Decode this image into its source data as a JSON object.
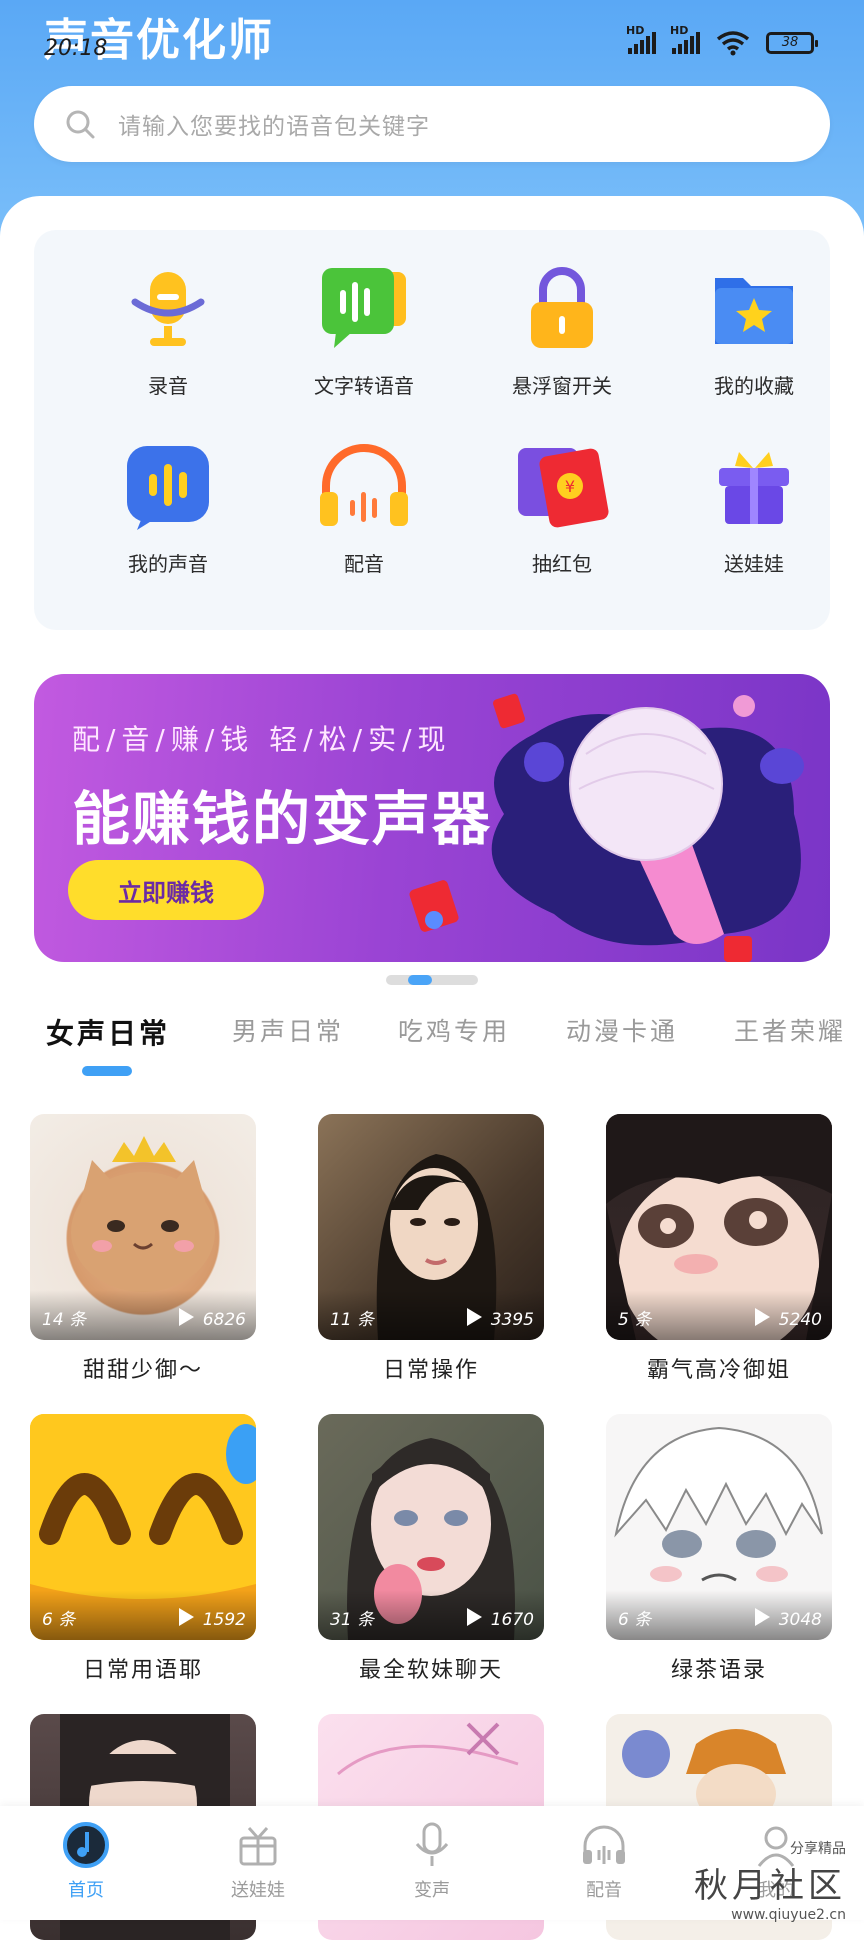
{
  "app": {
    "title": "声音优化师"
  },
  "status": {
    "time": "20:18",
    "signal_label": "HD",
    "battery": "38"
  },
  "search": {
    "placeholder": "请输入您要找的语音包关键字"
  },
  "features": [
    {
      "label": "录音",
      "icon": "microphone-icon"
    },
    {
      "label": "文字转语音",
      "icon": "chat-bubble-icon"
    },
    {
      "label": "悬浮窗开关",
      "icon": "lock-icon"
    },
    {
      "label": "我的收藏",
      "icon": "star-folder-icon"
    },
    {
      "label": "我的声音",
      "icon": "soundwave-icon"
    },
    {
      "label": "配音",
      "icon": "headphones-icon"
    },
    {
      "label": "抽红包",
      "icon": "red-envelope-icon"
    },
    {
      "label": "送娃娃",
      "icon": "gift-icon"
    }
  ],
  "banner": {
    "subtitle": "配/音/赚/钱   轻/松/实/现",
    "headline": "能赚钱的变声器",
    "cta": "立即赚钱"
  },
  "tabs": [
    "女声日常",
    "男声日常",
    "吃鸡专用",
    "动漫卡通",
    "王者荣耀"
  ],
  "active_tab": 0,
  "cards": [
    {
      "title": "甜甜少御～",
      "count": "14 条",
      "plays": "6826"
    },
    {
      "title": "日常操作",
      "count": "11 条",
      "plays": "3395"
    },
    {
      "title": "霸气高冷御姐",
      "count": "5 条",
      "plays": "5240"
    },
    {
      "title": "日常用语耶",
      "count": "6 条",
      "plays": "1592"
    },
    {
      "title": "最全软妹聊天",
      "count": "31 条",
      "plays": "1670"
    },
    {
      "title": "绿茶语录",
      "count": "6 条",
      "plays": "3048"
    }
  ],
  "nav": [
    {
      "label": "首页",
      "icon": "home-disc-icon",
      "active": true
    },
    {
      "label": "送娃娃",
      "icon": "gift-icon",
      "active": false
    },
    {
      "label": "变声",
      "icon": "microphone-icon",
      "active": false
    },
    {
      "label": "配音",
      "icon": "headphones-icon",
      "active": false
    },
    {
      "label": "我的",
      "icon": "user-icon",
      "active": false
    }
  ],
  "watermark": {
    "line1": "分享精品",
    "line2": "秋月社区",
    "line3": "www.qiuyue2.cn"
  },
  "colors": {
    "accent": "#3fa0f5",
    "header": "#5aa8f5",
    "banner": "#9a44d4",
    "cta": "#ffdd2b"
  }
}
